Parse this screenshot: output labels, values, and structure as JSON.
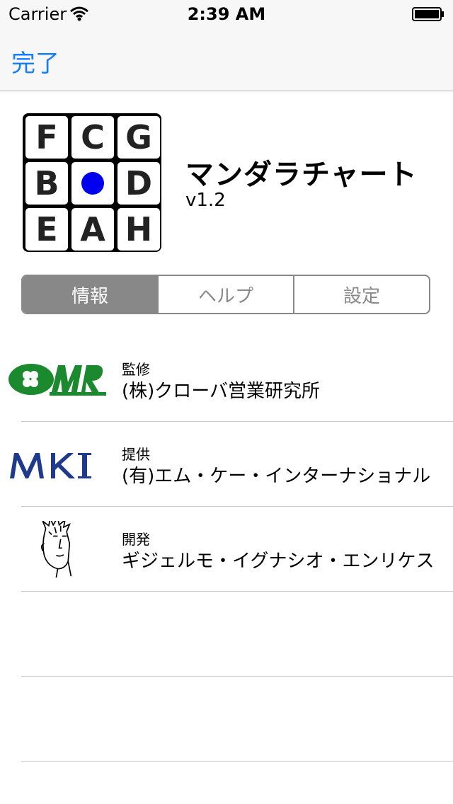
{
  "status_bar": {
    "carrier": "Carrier",
    "time": "2:39 AM"
  },
  "nav": {
    "done_label": "完了",
    "accent_color": "#157efb"
  },
  "app": {
    "logo_cells": [
      "F",
      "C",
      "G",
      "B",
      "",
      "D",
      "E",
      "A",
      "H"
    ],
    "title": "マンダラチャート",
    "version": "v1.2"
  },
  "segments": {
    "items": [
      "情報",
      "ヘルプ",
      "設定"
    ],
    "selected": 0
  },
  "credits": [
    {
      "role": "監修",
      "name": "(株)クローバ営業研究所",
      "icon": "clover-omr-logo"
    },
    {
      "role": "提供",
      "name": "(有)エム・ケー・インターナショナル",
      "icon": "mki-logo"
    },
    {
      "role": "開発",
      "name": "ギジェルモ・イグナシオ・エンリケス",
      "icon": "developer-portrait"
    }
  ]
}
